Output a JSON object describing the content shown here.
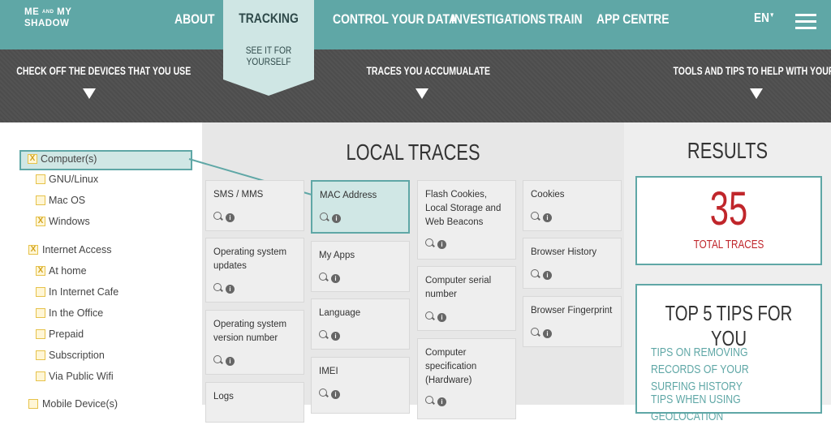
{
  "header": {
    "logo_top": "ME",
    "logo_and": "AND",
    "logo_my": "MY",
    "logo_bottom": "SHADOW",
    "nav": [
      "ABOUT",
      "CONTROL YOUR DATA",
      "INVESTIGATIONS",
      "TRAIN",
      "APP CENTRE"
    ],
    "tracking_label": "TRACKING",
    "tracking_sub": "SEE IT FOR YOURSELF",
    "lang": "EN",
    "menu_icon": "hamburger-icon"
  },
  "section_heads": {
    "left": "CHECK OFF THE DEVICES THAT YOU USE",
    "middle": "TRACES YOU ACCUMUALATE",
    "right": "TOOLS AND TIPS TO HELP WITH YOUR USE"
  },
  "devices": {
    "computer": {
      "label": "Computer(s)",
      "checked": true
    },
    "computer_items": [
      {
        "label": "GNU/Linux",
        "checked": false
      },
      {
        "label": "Mac OS",
        "checked": false
      },
      {
        "label": "Windows",
        "checked": true
      }
    ],
    "internet": {
      "label": "Internet Access",
      "checked": true
    },
    "internet_items": [
      {
        "label": "At home",
        "checked": true
      },
      {
        "label": "In Internet Cafe",
        "checked": false
      },
      {
        "label": "In the Office",
        "checked": false
      },
      {
        "label": "Prepaid",
        "checked": false
      },
      {
        "label": "Subscription",
        "checked": false
      },
      {
        "label": "Via Public Wifi",
        "checked": false
      }
    ],
    "mobile": {
      "label": "Mobile Device(s)",
      "checked": false
    }
  },
  "traces": {
    "title": "LOCAL TRACES",
    "col1": [
      "SMS / MMS",
      "Operating system updates",
      "Operating system version number",
      "Logs"
    ],
    "col2": [
      "MAC Address",
      "My Apps",
      "Language",
      "IMEI"
    ],
    "col3": [
      "Flash Cookies, Local Storage and Web Beacons",
      "Computer serial number",
      "Computer specification (Hardware)"
    ],
    "col4": [
      "Cookies",
      "Browser History",
      "Browser Fingerprint"
    ]
  },
  "results": {
    "title": "RESULTS",
    "count": "35",
    "count_label": "TOTAL TRACES",
    "tips_title": "TOP 5 TIPS FOR YOU",
    "tips": [
      "TIPS ON REMOVING RECORDS OF YOUR SURFING HISTORY",
      "TIPS WHEN USING GEOLOCATION"
    ]
  },
  "colors": {
    "teal": "#5fa7a6",
    "light_teal": "#d0e7e5",
    "dark_bar": "#4f4f4f",
    "red": "#c0262b"
  }
}
